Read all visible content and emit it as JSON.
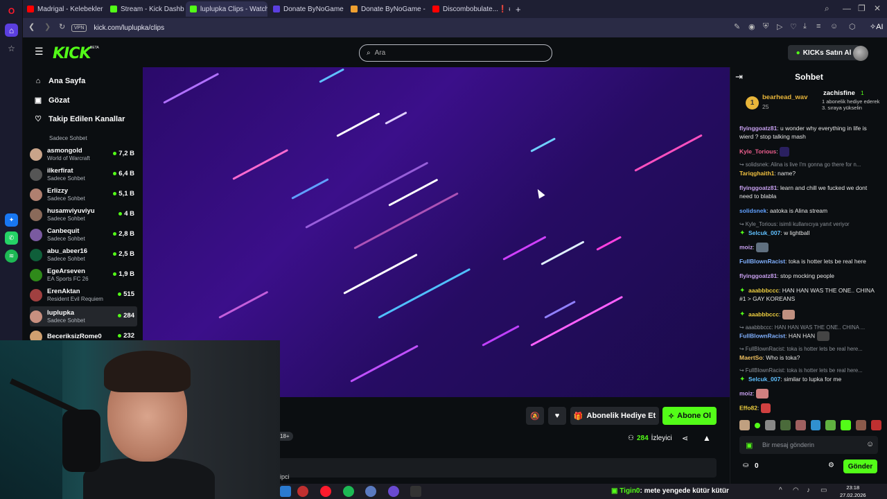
{
  "browser": {
    "tabs": [
      {
        "label": "Madrigal - Kelebekler - Yo",
        "color": "#ff0000",
        "active": false
      },
      {
        "label": "Stream - Kick Dashboard",
        "color": "#53fc18",
        "active": false
      },
      {
        "label": "luplupka Clips - Watch Liv",
        "color": "#53fc18",
        "active": true
      },
      {
        "label": "Donate ByNoGame",
        "color": "#5b3fe0",
        "active": false
      },
      {
        "label": "Donate ByNoGame - Gele",
        "color": "#f0a030",
        "active": false
      },
      {
        "label": "Discombobulate...❗ #Sh",
        "color": "#ff0000",
        "active": false
      }
    ],
    "new_tab": "+",
    "url": "kick.com/luplupka/clips",
    "vpn": "VPN",
    "ai_label": "AI"
  },
  "kick": {
    "logo": "KICK",
    "beta": "BETA",
    "search_placeholder": "Ara",
    "kicks_button": "KICKs Satın Al"
  },
  "sidebar": {
    "nav": [
      {
        "label": "Ana Sayfa",
        "icon": "home-icon"
      },
      {
        "label": "Gözat",
        "icon": "browse-icon"
      },
      {
        "label": "Takip Edilen Kanallar",
        "icon": "heart-icon"
      }
    ],
    "partial_top": "Sadece Sohbet",
    "channels": [
      {
        "name": "asmongold",
        "sub": "World of Warcraft",
        "count": "7,2 B",
        "color": "#c9a48a"
      },
      {
        "name": "ilkerfirat",
        "sub": "Sadece Sohbet",
        "count": "6,4 B",
        "color": "#444"
      },
      {
        "name": "Erlizzy",
        "sub": "Sadece Sohbet",
        "count": "5,1 B",
        "color": "#b08070"
      },
      {
        "name": "husamviyuviyu",
        "sub": "Sadece Sohbet",
        "count": "4 B",
        "color": "#8a6a5a"
      },
      {
        "name": "Canbequit",
        "sub": "Sadece Sohbet",
        "count": "2,8 B",
        "color": "#7a5aa0"
      },
      {
        "name": "abu_abeer16",
        "sub": "Sadece Sohbet",
        "count": "2,5 B",
        "color": "#0f5f3a"
      },
      {
        "name": "EgeArseven",
        "sub": "EA Sports FC 26",
        "count": "1,9 B",
        "color": "#53fc18"
      },
      {
        "name": "ErenAktan",
        "sub": "Resident Evil Requiem",
        "count": "515",
        "color": "#a04040"
      },
      {
        "name": "luplupka",
        "sub": "Sadece Sohbet",
        "count": "284",
        "color": "#c89080"
      },
      {
        "name": "BeceriksizRome0",
        "sub": "",
        "count": "232",
        "color": "#d0a070"
      }
    ]
  },
  "video_actions": {
    "gift_sub": "Abonelik Hediye Et",
    "subscribe": "Abone Ol",
    "viewer_count": "284",
    "viewer_label": "İzleyici",
    "age": "18+",
    "info_partial": "ipci"
  },
  "chat": {
    "title": "Sohbet",
    "pinned": {
      "user1": "bearhead_wav",
      "user1_count": "25",
      "user1_rank": "1",
      "user2": "zachisfine",
      "user2_count": "1",
      "user2_note": "1 abonelik hediye ederek 3. sıraya yükselin"
    },
    "messages": [
      {
        "user": "flyinggoatz81",
        "color": "#c8a0f0",
        "text": "u wonder why everything in life is wierd ? stop talking mash"
      },
      {
        "user": "Kyle_Torious",
        "color": "#f06090",
        "text": ""
      },
      {
        "reply": "solidsnek: Alina is live I'm gonna go there for n..."
      },
      {
        "user": "Tariqghaith1",
        "color": "#f0c040",
        "text": "name?"
      },
      {
        "user": "flyinggoatz81",
        "color": "#c8a0f0",
        "text": "learn and chill we fucked we dont need to blabla"
      },
      {
        "user": "solidsnek",
        "color": "#60a0ff",
        "text": "aatoka is Alina stream"
      },
      {
        "reply": "Kyle_Torious: isimli kullanıcıya yanıt veriyor"
      },
      {
        "user": "Selcuk_007",
        "color": "#60c0ff",
        "text": "w lightball"
      },
      {
        "user": "moiz",
        "color": "#c8a0f0",
        "text": ""
      },
      {
        "user": "FullBlownRacist",
        "color": "#80b0ff",
        "text": "toka is hotter lets be real here"
      },
      {
        "user": "flyinggoatz81",
        "color": "#c8a0f0",
        "text": "stop mocking people"
      },
      {
        "user": "aaabbbccc",
        "color": "#f0d040",
        "text": "HAN HAN WAS THE ONE.. CHINA #1 > GAY KOREANS"
      },
      {
        "user": "aaabbbccc",
        "color": "#f0d040",
        "text": ""
      },
      {
        "reply": "aaabbbccc: HAN HAN WAS THE ONE.. CHINA ..."
      },
      {
        "user": "FullBlownRacist",
        "color": "#80b0ff",
        "text": "HAN HAN"
      },
      {
        "reply": "FullBlownRacist: toka is hotter lets be real here..."
      },
      {
        "user": "MaertSo",
        "color": "#f0c060",
        "text": "Who is toka?"
      },
      {
        "reply": "FullBlownRacist: toka is hotter lets be real here..."
      },
      {
        "user": "Selcuk_007",
        "color": "#60c0ff",
        "text": "similar to lupka for me"
      },
      {
        "user": "moiz",
        "color": "#c8a0f0",
        "text": ""
      },
      {
        "user": "Effo82",
        "color": "#f0d040",
        "text": ""
      }
    ],
    "input_placeholder": "Bir mesaj gönderin",
    "points": "0",
    "send": "Gönder"
  },
  "taskbar": {
    "ticker_user": "Tigin0",
    "ticker_text": ": mete yengede kütür kütür",
    "time": "23:18",
    "date": "27.02.2026"
  }
}
